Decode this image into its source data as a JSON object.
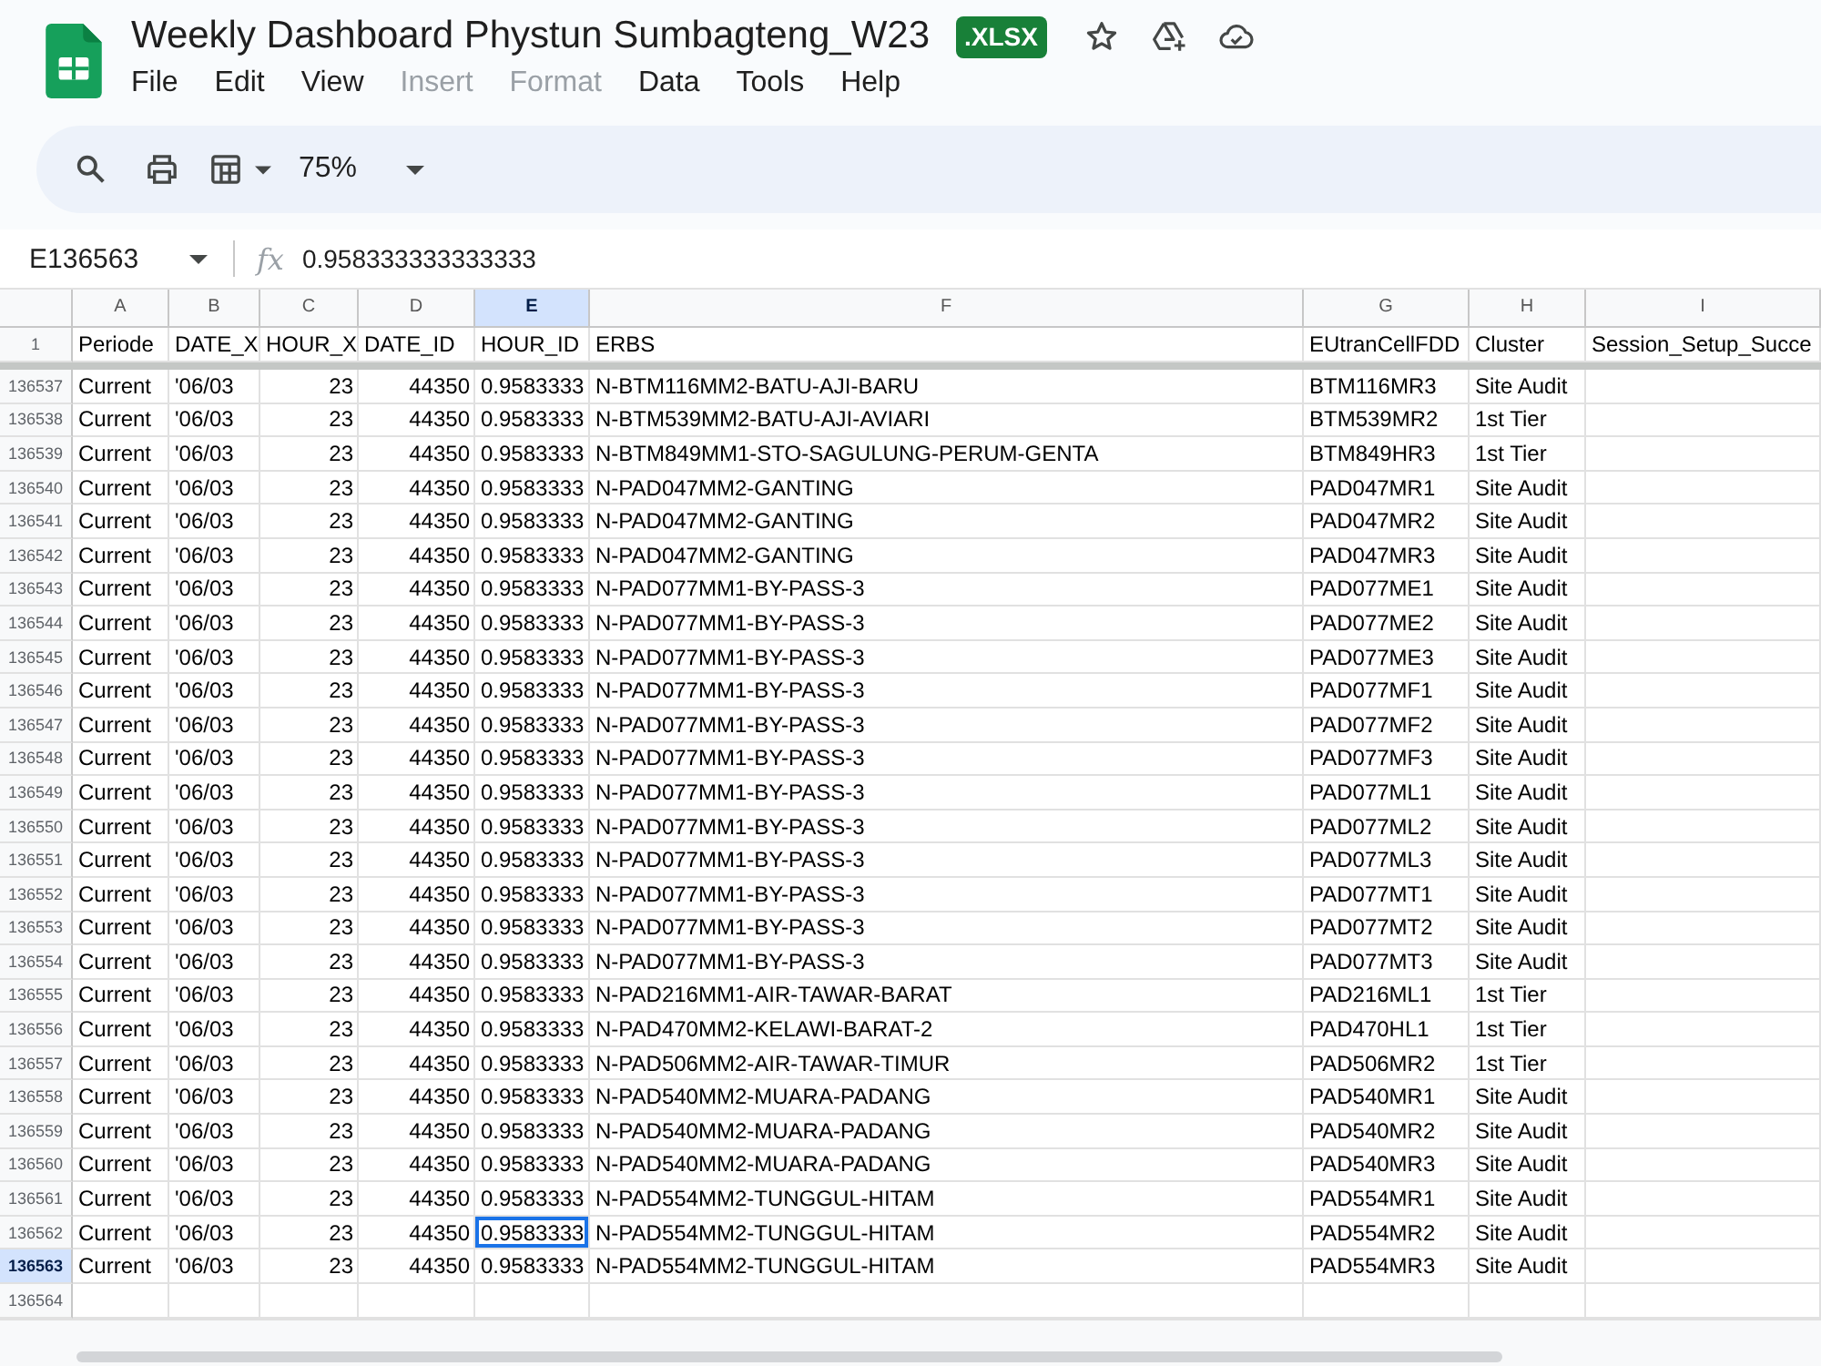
{
  "document": {
    "title": "Weekly Dashboard Phystun Sumbagteng_W23",
    "file_type": ".XLSX"
  },
  "menu": [
    {
      "label": "File",
      "disabled": false
    },
    {
      "label": "Edit",
      "disabled": false
    },
    {
      "label": "View",
      "disabled": false
    },
    {
      "label": "Insert",
      "disabled": true
    },
    {
      "label": "Format",
      "disabled": true
    },
    {
      "label": "Data",
      "disabled": false
    },
    {
      "label": "Tools",
      "disabled": false
    },
    {
      "label": "Help",
      "disabled": false
    }
  ],
  "toolbar": {
    "zoom": "75%"
  },
  "formula_bar": {
    "name_box": "E136563",
    "function_label": "fx",
    "value": "0.958333333333333"
  },
  "columns": [
    {
      "letter": "A",
      "kind": "text",
      "selected": false
    },
    {
      "letter": "B",
      "kind": "text",
      "selected": false
    },
    {
      "letter": "C",
      "kind": "number",
      "selected": false
    },
    {
      "letter": "D",
      "kind": "number",
      "selected": false
    },
    {
      "letter": "E",
      "kind": "text",
      "selected": true
    },
    {
      "letter": "F",
      "kind": "text",
      "selected": false
    },
    {
      "letter": "G",
      "kind": "text",
      "selected": false
    },
    {
      "letter": "H",
      "kind": "text",
      "selected": false
    },
    {
      "letter": "I",
      "kind": "text",
      "selected": false
    }
  ],
  "header_row": {
    "number": "1",
    "cells": [
      "Periode",
      "DATE_X",
      "HOUR_X",
      "DATE_ID",
      "HOUR_ID",
      "ERBS",
      "EUtranCellFDD",
      "Cluster",
      "Session_Setup_Succe"
    ]
  },
  "rows": [
    {
      "number": "136537",
      "selected": false,
      "cursor": false,
      "cells": [
        "Current",
        "'06/03",
        "23",
        "44350",
        "0.9583333",
        "N-BTM116MM2-BATU-AJI-BARU",
        "BTM116MR3",
        "Site Audit"
      ]
    },
    {
      "number": "136538",
      "selected": false,
      "cursor": false,
      "cells": [
        "Current",
        "'06/03",
        "23",
        "44350",
        "0.9583333",
        "N-BTM539MM2-BATU-AJI-AVIARI",
        "BTM539MR2",
        "1st Tier"
      ]
    },
    {
      "number": "136539",
      "selected": false,
      "cursor": false,
      "cells": [
        "Current",
        "'06/03",
        "23",
        "44350",
        "0.9583333",
        "N-BTM849MM1-STO-SAGULUNG-PERUM-GENTA",
        "BTM849HR3",
        "1st Tier"
      ]
    },
    {
      "number": "136540",
      "selected": false,
      "cursor": false,
      "cells": [
        "Current",
        "'06/03",
        "23",
        "44350",
        "0.9583333",
        "N-PAD047MM2-GANTING",
        "PAD047MR1",
        "Site Audit"
      ]
    },
    {
      "number": "136541",
      "selected": false,
      "cursor": false,
      "cells": [
        "Current",
        "'06/03",
        "23",
        "44350",
        "0.9583333",
        "N-PAD047MM2-GANTING",
        "PAD047MR2",
        "Site Audit"
      ]
    },
    {
      "number": "136542",
      "selected": false,
      "cursor": false,
      "cells": [
        "Current",
        "'06/03",
        "23",
        "44350",
        "0.9583333",
        "N-PAD047MM2-GANTING",
        "PAD047MR3",
        "Site Audit"
      ]
    },
    {
      "number": "136543",
      "selected": false,
      "cursor": false,
      "cells": [
        "Current",
        "'06/03",
        "23",
        "44350",
        "0.9583333",
        "N-PAD077MM1-BY-PASS-3",
        "PAD077ME1",
        "Site Audit"
      ]
    },
    {
      "number": "136544",
      "selected": false,
      "cursor": false,
      "cells": [
        "Current",
        "'06/03",
        "23",
        "44350",
        "0.9583333",
        "N-PAD077MM1-BY-PASS-3",
        "PAD077ME2",
        "Site Audit"
      ]
    },
    {
      "number": "136545",
      "selected": false,
      "cursor": false,
      "cells": [
        "Current",
        "'06/03",
        "23",
        "44350",
        "0.9583333",
        "N-PAD077MM1-BY-PASS-3",
        "PAD077ME3",
        "Site Audit"
      ]
    },
    {
      "number": "136546",
      "selected": false,
      "cursor": false,
      "cells": [
        "Current",
        "'06/03",
        "23",
        "44350",
        "0.9583333",
        "N-PAD077MM1-BY-PASS-3",
        "PAD077MF1",
        "Site Audit"
      ]
    },
    {
      "number": "136547",
      "selected": false,
      "cursor": false,
      "cells": [
        "Current",
        "'06/03",
        "23",
        "44350",
        "0.9583333",
        "N-PAD077MM1-BY-PASS-3",
        "PAD077MF2",
        "Site Audit"
      ]
    },
    {
      "number": "136548",
      "selected": false,
      "cursor": false,
      "cells": [
        "Current",
        "'06/03",
        "23",
        "44350",
        "0.9583333",
        "N-PAD077MM1-BY-PASS-3",
        "PAD077MF3",
        "Site Audit"
      ]
    },
    {
      "number": "136549",
      "selected": false,
      "cursor": false,
      "cells": [
        "Current",
        "'06/03",
        "23",
        "44350",
        "0.9583333",
        "N-PAD077MM1-BY-PASS-3",
        "PAD077ML1",
        "Site Audit"
      ]
    },
    {
      "number": "136550",
      "selected": false,
      "cursor": false,
      "cells": [
        "Current",
        "'06/03",
        "23",
        "44350",
        "0.9583333",
        "N-PAD077MM1-BY-PASS-3",
        "PAD077ML2",
        "Site Audit"
      ]
    },
    {
      "number": "136551",
      "selected": false,
      "cursor": false,
      "cells": [
        "Current",
        "'06/03",
        "23",
        "44350",
        "0.9583333",
        "N-PAD077MM1-BY-PASS-3",
        "PAD077ML3",
        "Site Audit"
      ]
    },
    {
      "number": "136552",
      "selected": false,
      "cursor": false,
      "cells": [
        "Current",
        "'06/03",
        "23",
        "44350",
        "0.9583333",
        "N-PAD077MM1-BY-PASS-3",
        "PAD077MT1",
        "Site Audit"
      ]
    },
    {
      "number": "136553",
      "selected": false,
      "cursor": false,
      "cells": [
        "Current",
        "'06/03",
        "23",
        "44350",
        "0.9583333",
        "N-PAD077MM1-BY-PASS-3",
        "PAD077MT2",
        "Site Audit"
      ]
    },
    {
      "number": "136554",
      "selected": false,
      "cursor": false,
      "cells": [
        "Current",
        "'06/03",
        "23",
        "44350",
        "0.9583333",
        "N-PAD077MM1-BY-PASS-3",
        "PAD077MT3",
        "Site Audit"
      ]
    },
    {
      "number": "136555",
      "selected": false,
      "cursor": false,
      "cells": [
        "Current",
        "'06/03",
        "23",
        "44350",
        "0.9583333",
        "N-PAD216MM1-AIR-TAWAR-BARAT",
        "PAD216ML1",
        "1st Tier"
      ]
    },
    {
      "number": "136556",
      "selected": false,
      "cursor": false,
      "cells": [
        "Current",
        "'06/03",
        "23",
        "44350",
        "0.9583333",
        "N-PAD470MM2-KELAWI-BARAT-2",
        "PAD470HL1",
        "1st Tier"
      ]
    },
    {
      "number": "136557",
      "selected": false,
      "cursor": false,
      "cells": [
        "Current",
        "'06/03",
        "23",
        "44350",
        "0.9583333",
        "N-PAD506MM2-AIR-TAWAR-TIMUR",
        "PAD506MR2",
        "1st Tier"
      ]
    },
    {
      "number": "136558",
      "selected": false,
      "cursor": false,
      "cells": [
        "Current",
        "'06/03",
        "23",
        "44350",
        "0.9583333",
        "N-PAD540MM2-MUARA-PADANG",
        "PAD540MR1",
        "Site Audit"
      ]
    },
    {
      "number": "136559",
      "selected": false,
      "cursor": false,
      "cells": [
        "Current",
        "'06/03",
        "23",
        "44350",
        "0.9583333",
        "N-PAD540MM2-MUARA-PADANG",
        "PAD540MR2",
        "Site Audit"
      ]
    },
    {
      "number": "136560",
      "selected": false,
      "cursor": false,
      "cells": [
        "Current",
        "'06/03",
        "23",
        "44350",
        "0.9583333",
        "N-PAD540MM2-MUARA-PADANG",
        "PAD540MR3",
        "Site Audit"
      ]
    },
    {
      "number": "136561",
      "selected": false,
      "cursor": false,
      "cells": [
        "Current",
        "'06/03",
        "23",
        "44350",
        "0.9583333",
        "N-PAD554MM2-TUNGGUL-HITAM",
        "PAD554MR1",
        "Site Audit"
      ]
    },
    {
      "number": "136562",
      "selected": false,
      "cursor": true,
      "cells": [
        "Current",
        "'06/03",
        "23",
        "44350",
        "0.9583333",
        "N-PAD554MM2-TUNGGUL-HITAM",
        "PAD554MR2",
        "Site Audit"
      ]
    },
    {
      "number": "136563",
      "selected": true,
      "cursor": false,
      "cells": [
        "Current",
        "'06/03",
        "23",
        "44350",
        "0.9583333",
        "N-PAD554MM2-TUNGGUL-HITAM",
        "PAD554MR3",
        "Site Audit"
      ]
    },
    {
      "number": "136564",
      "selected": false,
      "cursor": false
    }
  ]
}
